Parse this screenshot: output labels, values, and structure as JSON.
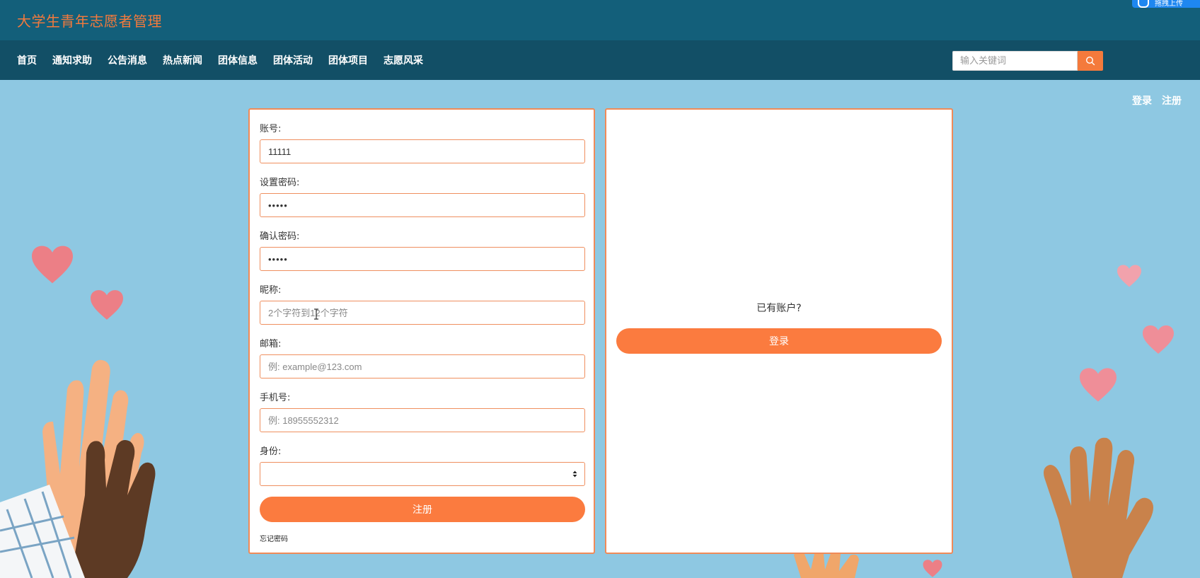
{
  "header": {
    "site_title": "大学生青年志愿者管理",
    "upload_badge": "拖拽上传"
  },
  "nav": {
    "items": [
      "首页",
      "通知求助",
      "公告消息",
      "热点新闻",
      "团体信息",
      "团体活动",
      "团体项目",
      "志愿风采"
    ],
    "search_placeholder": "输入关键词",
    "login": "登录",
    "register": "注册"
  },
  "register_form": {
    "account_label": "账号:",
    "account_value": "11111",
    "password_label": "设置密码:",
    "password_value": "•••••",
    "confirm_label": "确认密码:",
    "confirm_value": "•••••",
    "nickname_label": "昵称:",
    "nickname_placeholder": "2个字符到12个字符",
    "email_label": "邮箱:",
    "email_placeholder": "例: example@123.com",
    "phone_label": "手机号:",
    "phone_placeholder": "例: 18955552312",
    "identity_label": "身份:",
    "identity_value": "",
    "submit_label": "注册",
    "forgot_label": "忘记密码"
  },
  "login_panel": {
    "prompt": "已有账户?",
    "login_label": "登录"
  },
  "colors": {
    "header_bg": "#135f7a",
    "nav_bg": "#124f66",
    "accent": "#fb7b3f",
    "page_bg": "#8ec8e2"
  }
}
